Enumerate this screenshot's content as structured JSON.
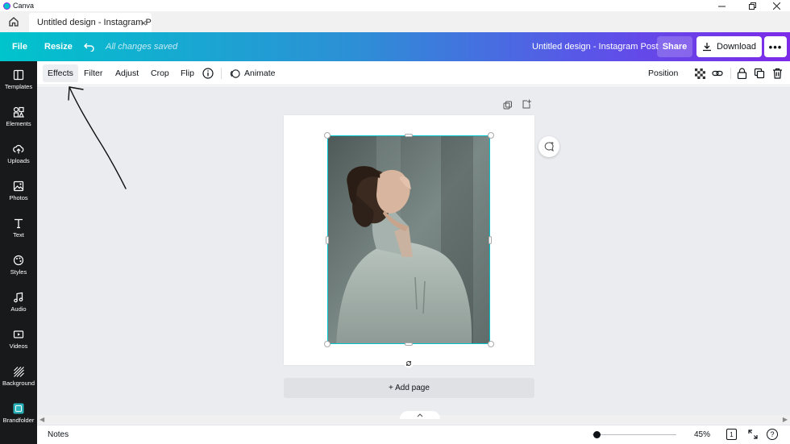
{
  "window": {
    "app_name": "Canva",
    "controls": [
      "minimize",
      "maximize",
      "close"
    ]
  },
  "tabs": {
    "home_icon": "home-icon",
    "active_tab_title": "Untitled design - Instagram P",
    "close_symbol": "×"
  },
  "topbar": {
    "file_label": "File",
    "resize_label": "Resize",
    "undo_icon": "undo-icon",
    "save_status": "All changes saved",
    "doc_title": "Untitled design - Instagram Post",
    "share_label": "Share",
    "download_label": "Download",
    "more_label": "•••"
  },
  "sidebar": {
    "items": [
      {
        "label": "Templates",
        "icon": "templates-icon"
      },
      {
        "label": "Elements",
        "icon": "elements-icon"
      },
      {
        "label": "Uploads",
        "icon": "uploads-icon"
      },
      {
        "label": "Photos",
        "icon": "photos-icon"
      },
      {
        "label": "Text",
        "icon": "text-icon"
      },
      {
        "label": "Styles",
        "icon": "styles-icon"
      },
      {
        "label": "Audio",
        "icon": "audio-icon"
      },
      {
        "label": "Videos",
        "icon": "videos-icon"
      },
      {
        "label": "Background",
        "icon": "background-icon"
      },
      {
        "label": "Brandfolder",
        "icon": "brandfolder-icon"
      }
    ]
  },
  "context_toolbar": {
    "effects_label": "Effects",
    "filter_label": "Filter",
    "adjust_label": "Adjust",
    "crop_label": "Crop",
    "flip_label": "Flip",
    "animate_label": "Animate",
    "position_label": "Position"
  },
  "canvas": {
    "add_page_label": "+ Add page"
  },
  "bottombar": {
    "notes_label": "Notes",
    "zoom_value": "45%",
    "zoom_fraction": 0.05,
    "page_count": "1",
    "help_label": "?"
  },
  "colors": {
    "gradient_start": "#00c4cc",
    "gradient_end": "#7d2ae8",
    "sidebar_bg": "#18191b",
    "selection": "#00c4cc"
  }
}
